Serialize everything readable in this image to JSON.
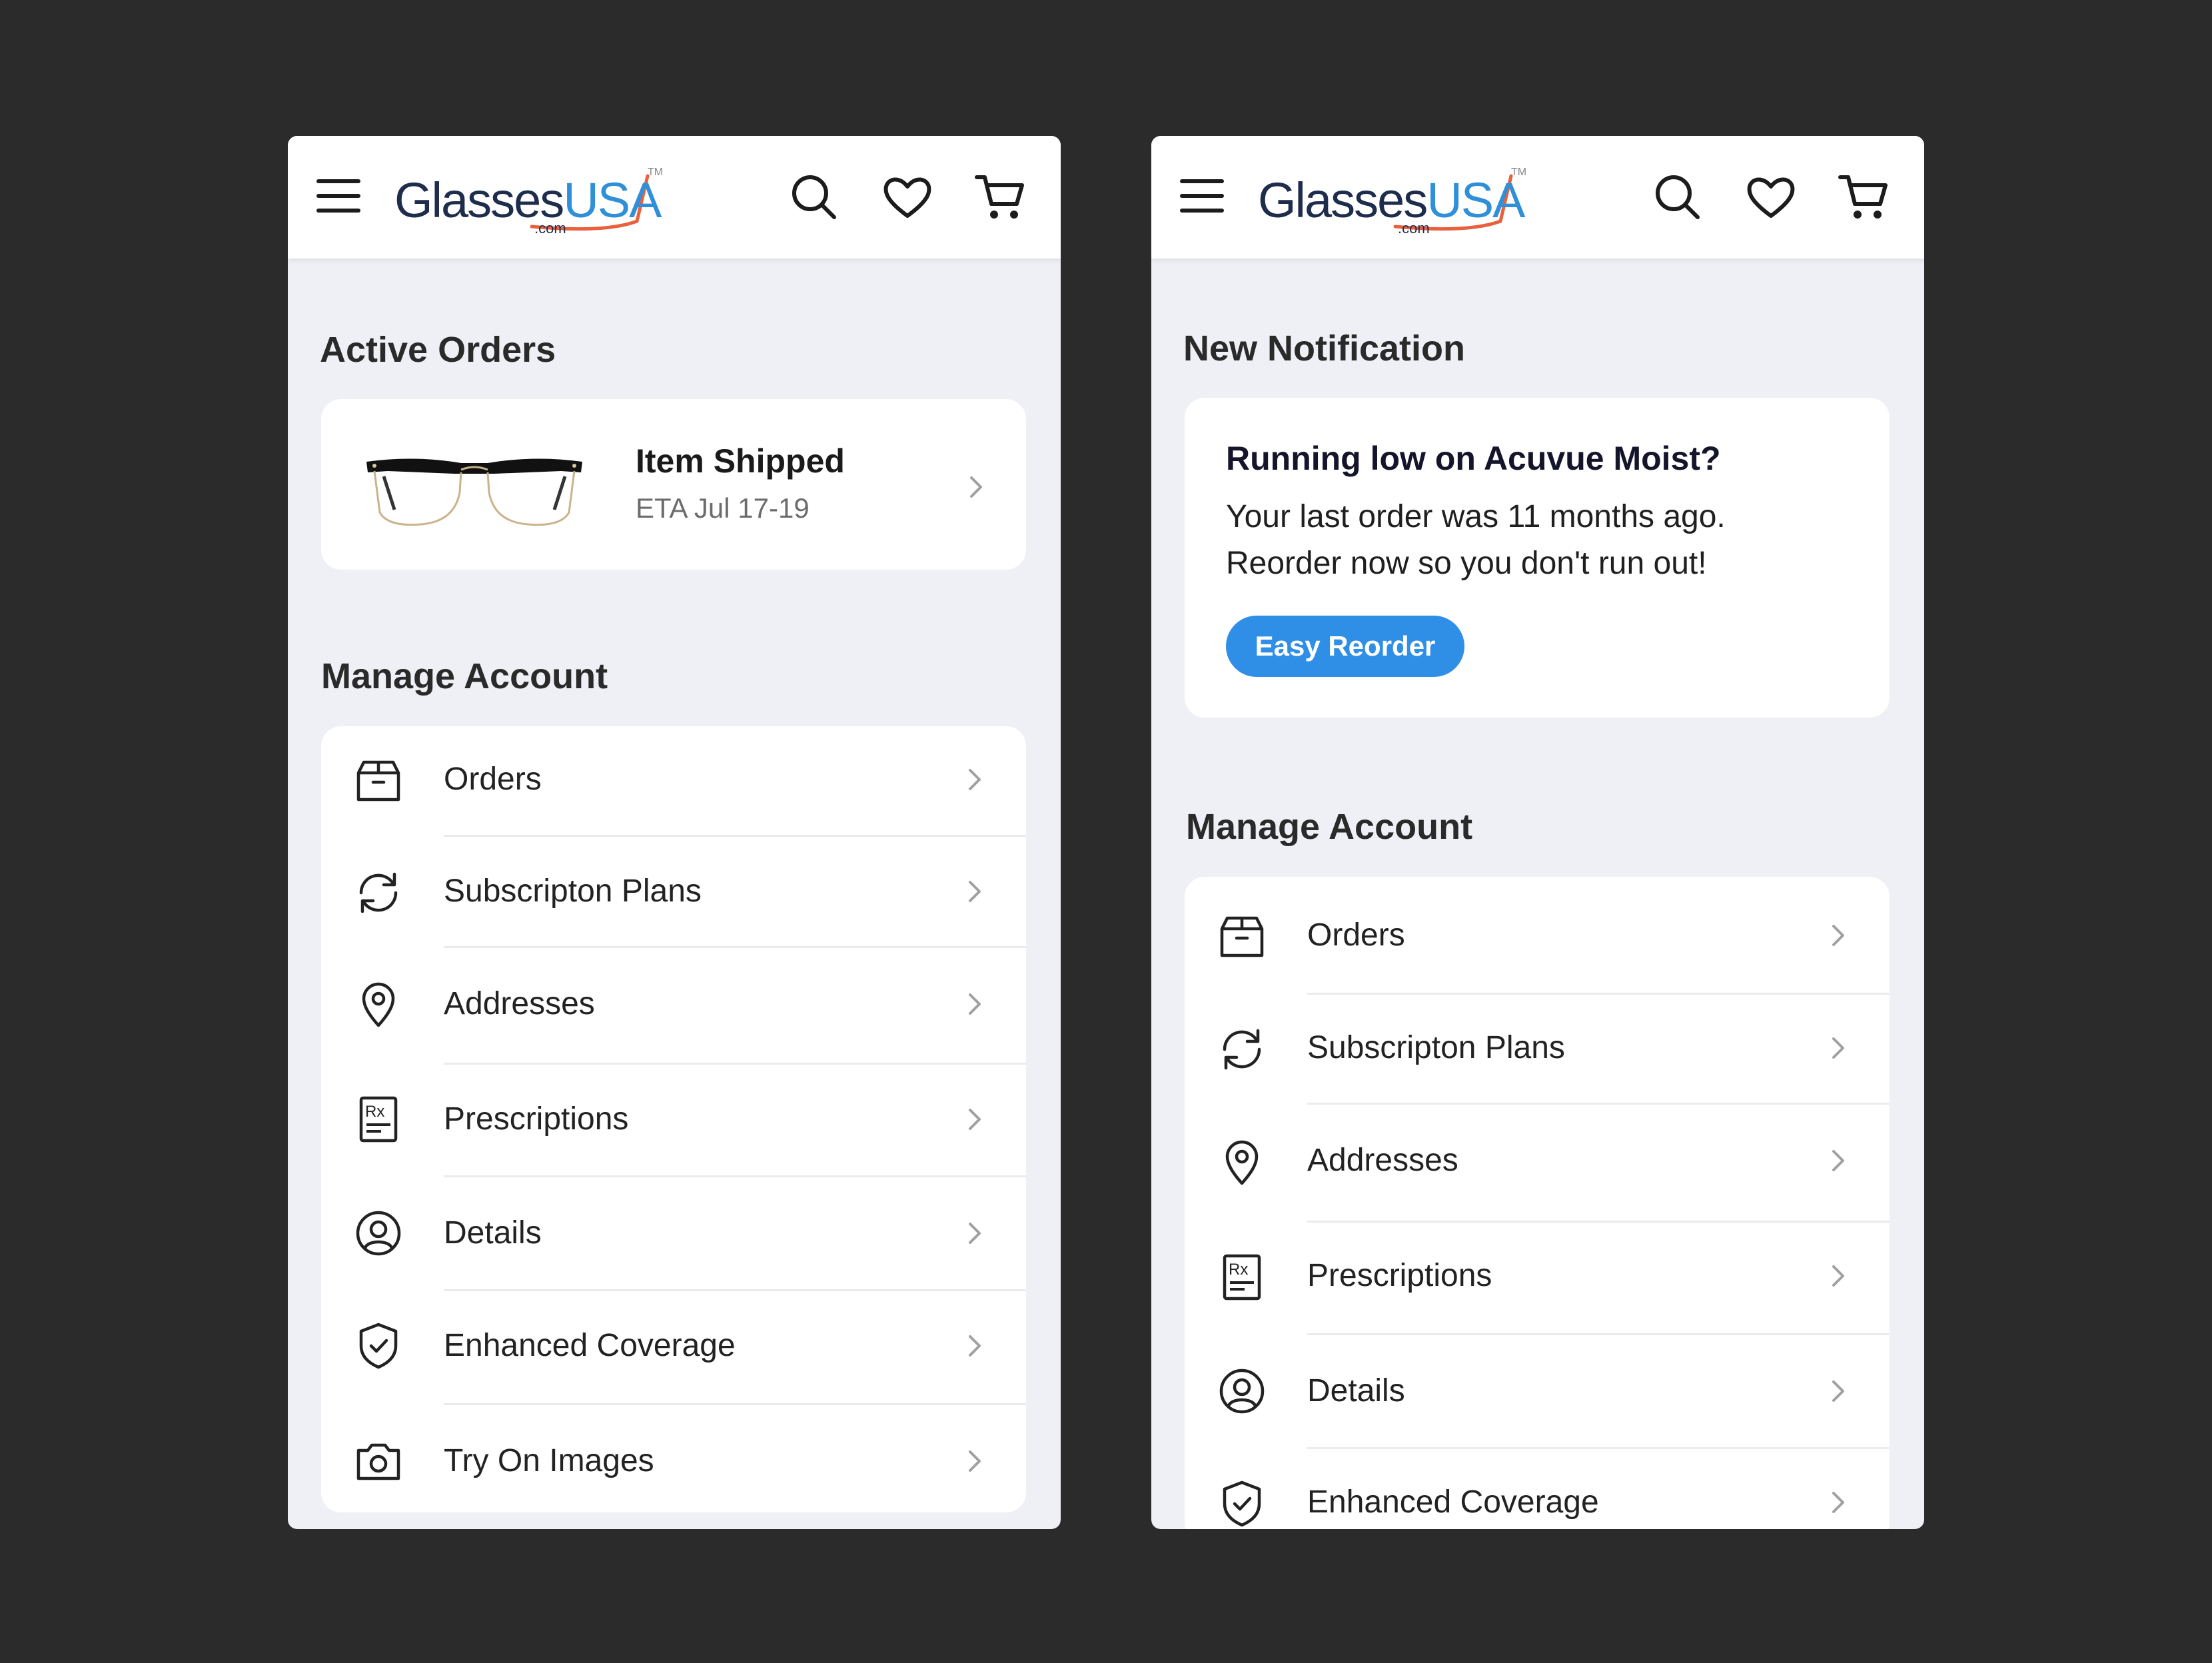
{
  "brand": {
    "word1": "Glasses",
    "word2": "USA",
    "dotcom": ".com",
    "tm": "TM",
    "navy": "#1f2d4d",
    "blue": "#2f8fd8",
    "swoosh": "#e8603c"
  },
  "icons": {
    "menu": "hamburger-icon",
    "search": "search-icon",
    "wishlist": "heart-icon",
    "cart": "cart-icon",
    "chevron": "chevron-right-icon"
  },
  "left": {
    "active_orders_title": "Active Orders",
    "order": {
      "status": "Item Shipped",
      "eta": "ETA Jul 17-19"
    },
    "manage_title": "Manage Account",
    "menu": [
      {
        "label": "Orders",
        "icon": "box-icon"
      },
      {
        "label": "Subscripton Plans",
        "icon": "refresh-icon"
      },
      {
        "label": "Addresses",
        "icon": "location-pin-icon"
      },
      {
        "label": "Prescriptions",
        "icon": "prescription-icon"
      },
      {
        "label": "Details",
        "icon": "user-icon"
      },
      {
        "label": "Enhanced Coverage",
        "icon": "shield-check-icon"
      },
      {
        "label": "Try On Images",
        "icon": "camera-icon"
      }
    ]
  },
  "right": {
    "notification_title": "New Notification",
    "notification": {
      "headline": "Running low on Acuvue Moist?",
      "line1": "Your last order was 11 months ago.",
      "line2": "Reorder now so you don't run out!",
      "button": "Easy Reorder"
    },
    "manage_title": "Manage Account",
    "menu": [
      {
        "label": "Orders",
        "icon": "box-icon"
      },
      {
        "label": "Subscripton Plans",
        "icon": "refresh-icon"
      },
      {
        "label": "Addresses",
        "icon": "location-pin-icon"
      },
      {
        "label": "Prescriptions",
        "icon": "prescription-icon"
      },
      {
        "label": "Details",
        "icon": "user-icon"
      },
      {
        "label": "Enhanced Coverage",
        "icon": "shield-check-icon"
      }
    ]
  },
  "colors": {
    "background": "#2b2b2b",
    "screen": "#eff0f5",
    "card": "#ffffff",
    "accent_button": "#2f8ee6"
  }
}
